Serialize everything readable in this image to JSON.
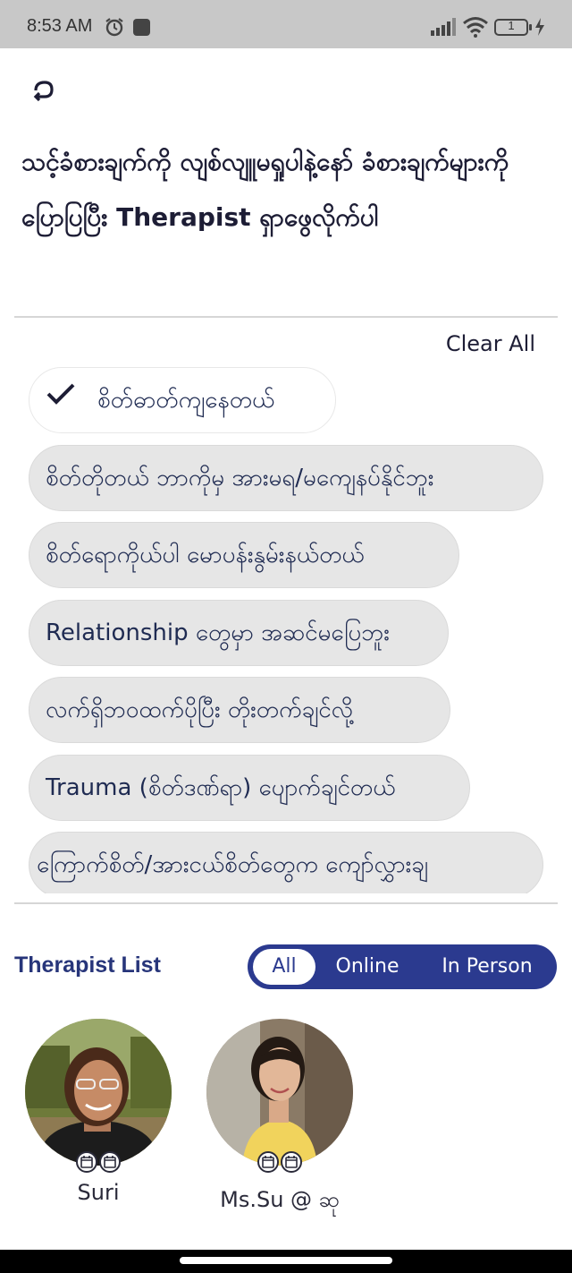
{
  "status_bar": {
    "time": "8:53 AM",
    "battery_level": "1",
    "icons": [
      "alarm-icon",
      "app-notification-icon",
      "signal-icon",
      "wifi-icon",
      "battery-icon",
      "charging-icon"
    ]
  },
  "header": {
    "back_icon": "back-arrow-icon",
    "title": "သင့်ခံစားချက်ကို လျစ်လျူမရှုပါနဲ့နော် ခံစားချက်များကို ပြောပြပြီး Therapist ရှာဖွေလိုက်ပါ"
  },
  "filters": {
    "clear_all_label": "Clear All",
    "chips": [
      {
        "label": "စိတ်ဓာတ်ကျနေတယ်",
        "selected": true
      },
      {
        "label": "စိတ်တိုတယ် ဘာကိုမှ အားမရ/မကျေနပ်နိုင်ဘူး",
        "selected": false
      },
      {
        "label": "စိတ်ရောကိုယ်ပါ မောပန်းနွမ်းနယ်တယ်",
        "selected": false
      },
      {
        "label": "Relationship တွေမှာ အဆင်မပြေဘူး",
        "selected": false
      },
      {
        "label": "လက်ရှိဘဝထက်ပိုပြီး တိုးတက်ချင်လို့",
        "selected": false
      },
      {
        "label": "Trauma (စိတ်ဒဏ်ရာ) ပျောက်ချင်တယ်",
        "selected": false
      },
      {
        "label": "ကြောက်စိတ်/အားငယ်စိတ်တွေက ကျော်လွှားချ",
        "selected": false
      }
    ]
  },
  "therapist_list": {
    "title": "Therapist List",
    "segments": [
      "All",
      "Online",
      "In Person"
    ],
    "active_segment": "All",
    "therapists": [
      {
        "name": "Suri",
        "modes": [
          "calendar-icon",
          "calendar-icon"
        ]
      },
      {
        "name": "Ms.Su @ ဆု",
        "modes": [
          "calendar-icon",
          "calendar-icon"
        ]
      }
    ]
  },
  "colors": {
    "accent": "#2b3a8f",
    "chip_bg": "#e6e6e6",
    "chip_text": "#1f2b52",
    "status_bar": "#c8c8c8"
  }
}
